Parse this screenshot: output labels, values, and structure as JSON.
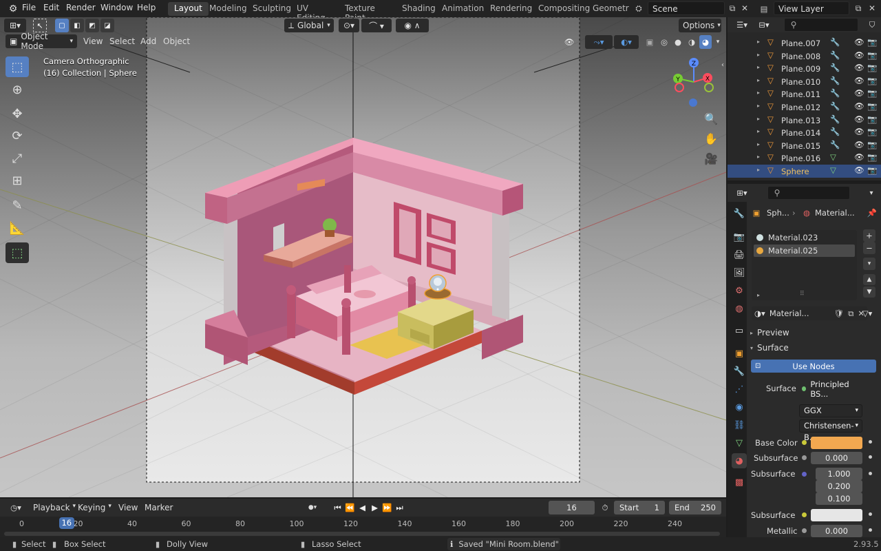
{
  "menu": {
    "file": "File",
    "edit": "Edit",
    "render": "Render",
    "window": "Window",
    "help": "Help"
  },
  "workspaces": [
    "Layout",
    "Modeling",
    "Sculpting",
    "UV Editing",
    "Texture Paint",
    "Shading",
    "Animation",
    "Rendering",
    "Compositing",
    "Geometr"
  ],
  "scene": {
    "name": "Scene",
    "view_layer": "View Layer"
  },
  "viewport_header": {
    "transform": "Global",
    "options": "Options"
  },
  "viewport_menu": {
    "mode": "Object Mode",
    "view": "View",
    "select": "Select",
    "add": "Add",
    "object": "Object"
  },
  "viewport_overlay": {
    "line1": "Camera Orthographic",
    "line2": "(16) Collection | Sphere"
  },
  "outliner": {
    "rows": [
      {
        "name": "Plane.007"
      },
      {
        "name": "Plane.008"
      },
      {
        "name": "Plane.009"
      },
      {
        "name": "Plane.010"
      },
      {
        "name": "Plane.011"
      },
      {
        "name": "Plane.012"
      },
      {
        "name": "Plane.013"
      },
      {
        "name": "Plane.014"
      },
      {
        "name": "Plane.015"
      },
      {
        "name": "Plane.016"
      },
      {
        "name": "Sphere"
      }
    ]
  },
  "properties": {
    "breadcrumb_object": "Sph...",
    "breadcrumb_material": "Material...",
    "slots": [
      "Material.023",
      "Material.025"
    ],
    "material_name": "Material...",
    "preview": "Preview",
    "surface_panel": "Surface",
    "use_nodes": "Use Nodes",
    "surface_label": "Surface",
    "surface_value": "Principled BS...",
    "distribution": "GGX",
    "subsurface_method": "Christensen-B...",
    "base_color_label": "Base Color",
    "base_color": "#f2a850",
    "subsurface_label": "Subsurface",
    "subsurface_value": "0.000",
    "subsurface_radius_label": "Subsurface",
    "radius": [
      "1.000",
      "0.200",
      "0.100"
    ],
    "subsurface_color_label": "Subsurface",
    "subsurface_color": "#e6e6e6",
    "metallic_label": "Metallic",
    "metallic_value": "0.000"
  },
  "timeline": {
    "playback": "Playback",
    "keying": "Keying",
    "view": "View",
    "marker": "Marker",
    "current_frame": "16",
    "start_label": "Start",
    "start": "1",
    "end_label": "End",
    "end": "250",
    "ticks": [
      "0",
      "20",
      "40",
      "60",
      "80",
      "100",
      "120",
      "140",
      "160",
      "180",
      "200",
      "220",
      "240"
    ],
    "playhead": "16"
  },
  "statusbar": {
    "select": "Select",
    "box_select": "Box Select",
    "dolly": "Dolly View",
    "lasso": "Lasso Select",
    "message": "Saved \"Mini Room.blend\"",
    "version": "2.93.5"
  },
  "colors": {
    "accent": "#5680c2",
    "selection": "#334d80",
    "active_object": "#f0a030"
  }
}
